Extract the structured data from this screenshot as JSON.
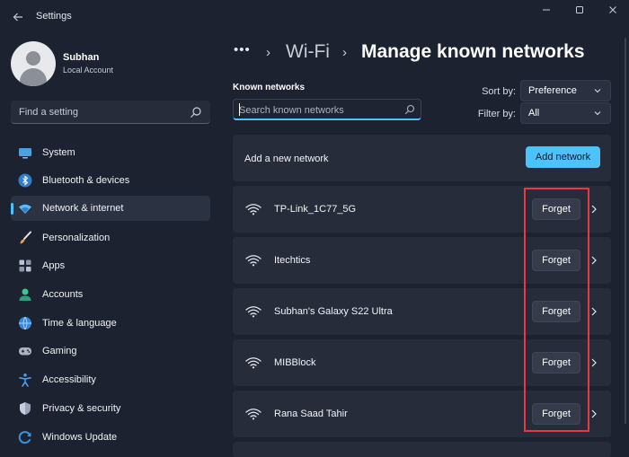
{
  "window": {
    "title": "Settings",
    "controls": {
      "minimize": "minimize",
      "maximize": "maximize",
      "close": "close"
    }
  },
  "user": {
    "name": "Subhan",
    "account_type": "Local Account"
  },
  "sidebar": {
    "search_placeholder": "Find a setting",
    "items": [
      {
        "label": "System",
        "icon": "system-icon",
        "active": false
      },
      {
        "label": "Bluetooth & devices",
        "icon": "bluetooth-icon",
        "active": false
      },
      {
        "label": "Network & internet",
        "icon": "network-icon",
        "active": true
      },
      {
        "label": "Personalization",
        "icon": "brush-icon",
        "active": false
      },
      {
        "label": "Apps",
        "icon": "apps-icon",
        "active": false
      },
      {
        "label": "Accounts",
        "icon": "accounts-icon",
        "active": false
      },
      {
        "label": "Time & language",
        "icon": "time-language-icon",
        "active": false
      },
      {
        "label": "Gaming",
        "icon": "gamepad-icon",
        "active": false
      },
      {
        "label": "Accessibility",
        "icon": "accessibility-icon",
        "active": false
      },
      {
        "label": "Privacy & security",
        "icon": "shield-icon",
        "active": false
      },
      {
        "label": "Windows Update",
        "icon": "update-icon",
        "active": false
      }
    ]
  },
  "breadcrumb": {
    "overflow": "•••",
    "separator": "›",
    "parent": "Wi-Fi",
    "current": "Manage known networks"
  },
  "known_networks": {
    "heading": "Known networks",
    "search_placeholder": "Search known networks",
    "sort_label": "Sort by:",
    "sort_value": "Preference",
    "filter_label": "Filter by:",
    "filter_value": "All",
    "add_label": "Add a new network",
    "add_button": "Add network",
    "forget_label": "Forget",
    "networks": [
      {
        "name": "TP-Link_1C77_5G"
      },
      {
        "name": "Itechtics"
      },
      {
        "name": "Subhan's Galaxy S22 Ultra"
      },
      {
        "name": "MIBBlock"
      },
      {
        "name": "Rana Saad Tahir"
      }
    ]
  },
  "colors": {
    "background": "#1c2230",
    "card": "#262c3a",
    "accent": "#4cc2ff",
    "highlight": "#e53a3f"
  }
}
